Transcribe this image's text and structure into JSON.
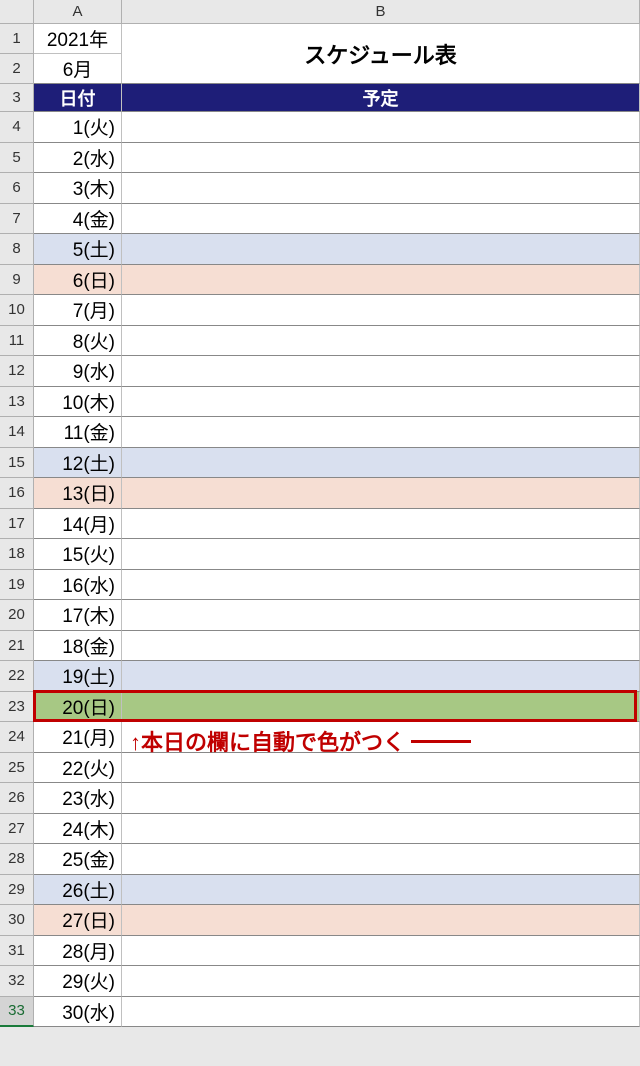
{
  "columns": {
    "A": "A",
    "B": "B"
  },
  "header": {
    "year": "2021年",
    "month": "6月",
    "title": "スケジュール表",
    "col_date": "日付",
    "col_plan": "予定"
  },
  "rows": [
    {
      "n": 1,
      "date": "1(火)",
      "plan": "",
      "class": ""
    },
    {
      "n": 2,
      "date": "2(水)",
      "plan": "",
      "class": ""
    },
    {
      "n": 3,
      "date": "3(木)",
      "plan": "",
      "class": ""
    },
    {
      "n": 4,
      "date": "4(金)",
      "plan": "",
      "class": ""
    },
    {
      "n": 5,
      "date": "5(土)",
      "plan": "",
      "class": "sat"
    },
    {
      "n": 6,
      "date": "6(日)",
      "plan": "",
      "class": "sun"
    },
    {
      "n": 7,
      "date": "7(月)",
      "plan": "",
      "class": ""
    },
    {
      "n": 8,
      "date": "8(火)",
      "plan": "",
      "class": ""
    },
    {
      "n": 9,
      "date": "9(水)",
      "plan": "",
      "class": ""
    },
    {
      "n": 10,
      "date": "10(木)",
      "plan": "",
      "class": ""
    },
    {
      "n": 11,
      "date": "11(金)",
      "plan": "",
      "class": ""
    },
    {
      "n": 12,
      "date": "12(土)",
      "plan": "",
      "class": "sat"
    },
    {
      "n": 13,
      "date": "13(日)",
      "plan": "",
      "class": "sun"
    },
    {
      "n": 14,
      "date": "14(月)",
      "plan": "",
      "class": ""
    },
    {
      "n": 15,
      "date": "15(火)",
      "plan": "",
      "class": ""
    },
    {
      "n": 16,
      "date": "16(水)",
      "plan": "",
      "class": ""
    },
    {
      "n": 17,
      "date": "17(木)",
      "plan": "",
      "class": ""
    },
    {
      "n": 18,
      "date": "18(金)",
      "plan": "",
      "class": ""
    },
    {
      "n": 19,
      "date": "19(土)",
      "plan": "",
      "class": "sat"
    },
    {
      "n": 20,
      "date": "20(日)",
      "plan": "",
      "class": "today"
    },
    {
      "n": 21,
      "date": "21(月)",
      "plan": "",
      "class": ""
    },
    {
      "n": 22,
      "date": "22(火)",
      "plan": "",
      "class": ""
    },
    {
      "n": 23,
      "date": "23(水)",
      "plan": "",
      "class": ""
    },
    {
      "n": 24,
      "date": "24(木)",
      "plan": "",
      "class": ""
    },
    {
      "n": 25,
      "date": "25(金)",
      "plan": "",
      "class": ""
    },
    {
      "n": 26,
      "date": "26(土)",
      "plan": "",
      "class": "sat"
    },
    {
      "n": 27,
      "date": "27(日)",
      "plan": "",
      "class": "sun"
    },
    {
      "n": 28,
      "date": "28(月)",
      "plan": "",
      "class": ""
    },
    {
      "n": 29,
      "date": "29(火)",
      "plan": "",
      "class": ""
    },
    {
      "n": 30,
      "date": "30(水)",
      "plan": "",
      "class": ""
    }
  ],
  "rownums": [
    "1",
    "2",
    "3",
    "4",
    "5",
    "6",
    "7",
    "8",
    "9",
    "10",
    "11",
    "12",
    "13",
    "14",
    "15",
    "16",
    "17",
    "18",
    "19",
    "20",
    "21",
    "22",
    "23",
    "24",
    "25",
    "26",
    "27",
    "28",
    "29",
    "30",
    "31",
    "32",
    "33"
  ],
  "annotation": "↑本日の欄に自動で色がつく"
}
